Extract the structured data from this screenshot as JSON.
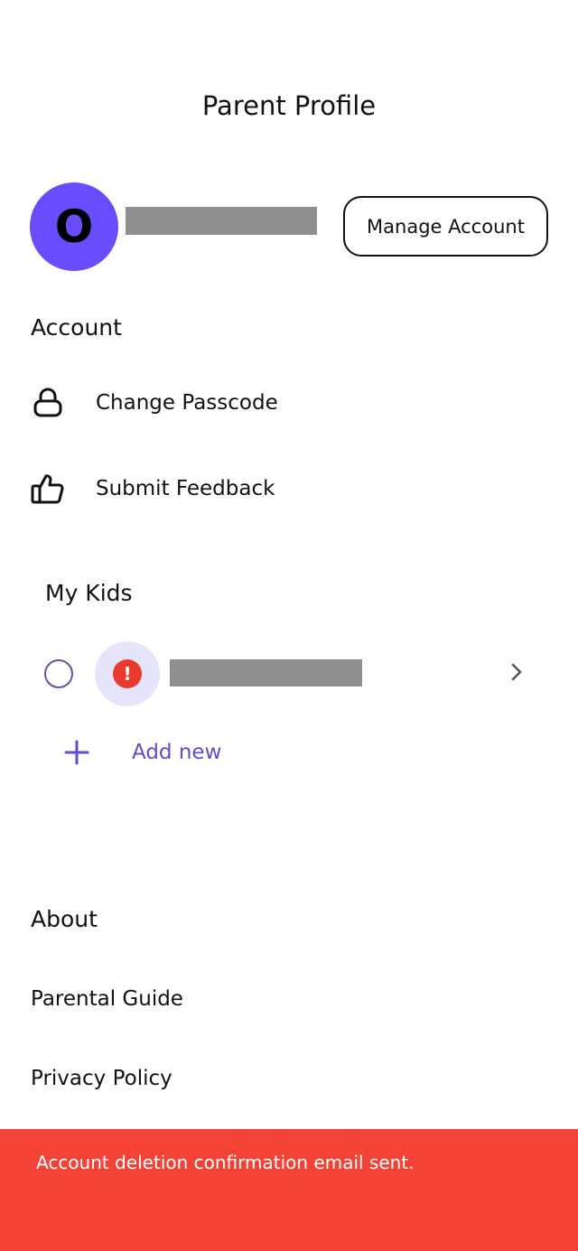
{
  "header": {
    "title": "Parent Profile"
  },
  "profile": {
    "avatar_initial": "O",
    "manage_button": "Manage Account"
  },
  "account": {
    "heading": "Account",
    "items": [
      {
        "label": "Change Passcode",
        "icon": "lock-icon"
      },
      {
        "label": "Submit Feedback",
        "icon": "thumbs-up-icon"
      }
    ]
  },
  "kids": {
    "heading": "My Kids",
    "alert_symbol": "!",
    "add_label": "Add new"
  },
  "about": {
    "heading": "About",
    "links": [
      "Parental Guide",
      "Privacy Policy"
    ]
  },
  "toast": {
    "message": "Account deletion confirmation email sent.",
    "color": "#f44336"
  },
  "colors": {
    "accent": "#6a4cff",
    "link": "#5a4fcf",
    "alert": "#ea3a2e"
  }
}
